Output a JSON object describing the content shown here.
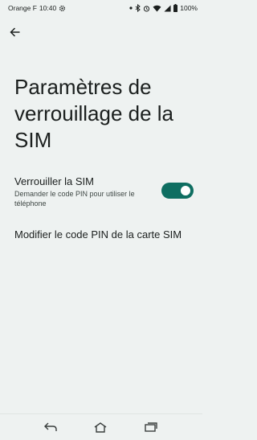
{
  "status_bar": {
    "carrier": "Orange F",
    "time": "10:40",
    "battery": "100%",
    "icons": [
      "settings-icon",
      "dot-icon",
      "bluetooth-icon",
      "alarm-icon",
      "wifi-icon",
      "signal-icon",
      "battery-icon"
    ]
  },
  "header": {
    "back_icon": "arrow-back-icon"
  },
  "page": {
    "title": "Paramètres de verrouillage de la SIM",
    "lock_sim": {
      "title": "Verrouiller la SIM",
      "summary": "Demander le code PIN pour utiliser le téléphone",
      "enabled": true,
      "accent_color": "#0e6e61"
    },
    "change_pin": {
      "label": "Modifier le code PIN de la carte SIM"
    }
  },
  "nav_bar": {
    "icons": [
      "nav-back-icon",
      "nav-home-icon",
      "nav-recents-icon"
    ]
  }
}
